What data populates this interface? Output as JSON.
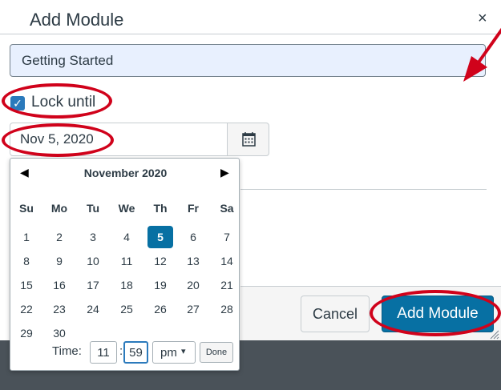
{
  "dialog": {
    "title": "Add Module",
    "close_icon": "close-icon",
    "close_glyph": "×"
  },
  "module_name": {
    "value": "Getting Started"
  },
  "lock": {
    "checked": true,
    "label": "Lock until",
    "check_glyph": "✓"
  },
  "date_field": {
    "value": "Nov 5, 2020",
    "icon": "calendar-icon"
  },
  "datepicker": {
    "prev_glyph": "◀",
    "next_glyph": "▶",
    "month_label": "November 2020",
    "weekdays": [
      "Su",
      "Mo",
      "Tu",
      "We",
      "Th",
      "Fr",
      "Sa"
    ],
    "weeks": [
      [
        "1",
        "2",
        "3",
        "4",
        "5",
        "6",
        "7"
      ],
      [
        "8",
        "9",
        "10",
        "11",
        "12",
        "13",
        "14"
      ],
      [
        "15",
        "16",
        "17",
        "18",
        "19",
        "20",
        "21"
      ],
      [
        "22",
        "23",
        "24",
        "25",
        "26",
        "27",
        "28"
      ],
      [
        "29",
        "30",
        "",
        "",
        "",
        "",
        ""
      ]
    ],
    "selected_day": "5",
    "time_label": "Time:",
    "hour": "11",
    "colon": ":",
    "minute": "59",
    "ampm": "pm",
    "ampm_chevron": "▾",
    "done_label": "Done"
  },
  "footer": {
    "cancel_label": "Cancel",
    "add_label": "Add Module"
  },
  "colors": {
    "primary": "#0770a3",
    "checkbox": "#2b7abc",
    "annotation": "#d0021b",
    "input_autofill": "#e8f0fe"
  }
}
